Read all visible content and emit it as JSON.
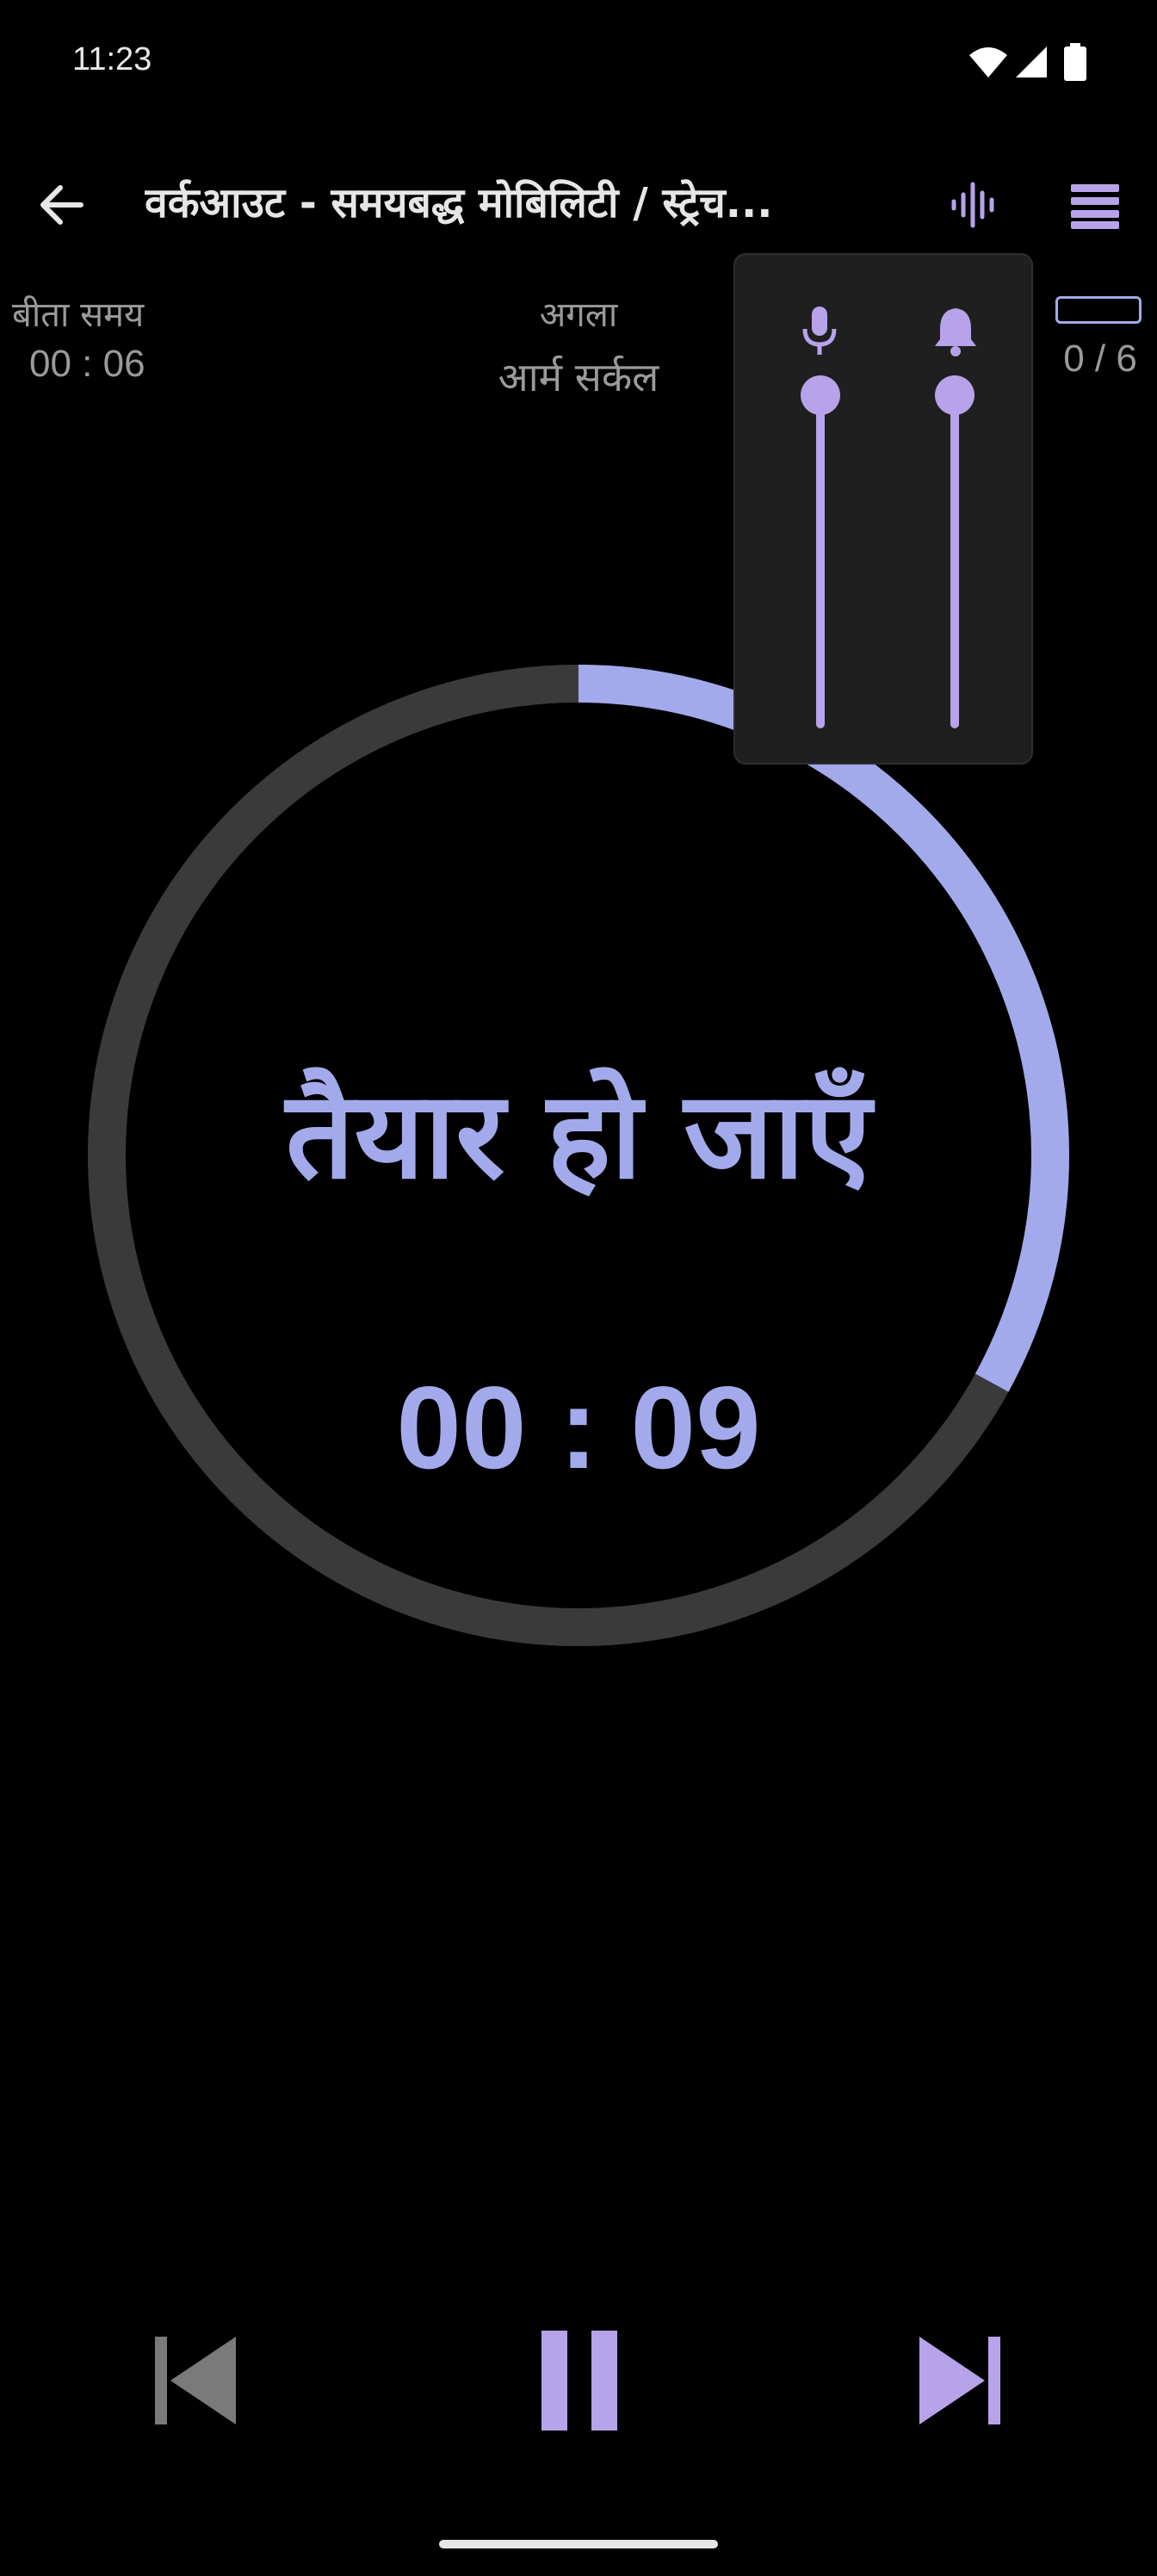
{
  "status_bar": {
    "time": "11:23",
    "icons": [
      "wifi-icon",
      "cellular-signal-icon",
      "battery-icon"
    ]
  },
  "app_bar": {
    "title": "वर्कआउट - समयबद्ध मोबिलिटी / स्ट्रेच...",
    "back_icon": "arrow-left-icon",
    "sound_icon": "audio-wave-icon",
    "menu_icon": "menu-icon"
  },
  "info": {
    "elapsed_label": "बीता समय",
    "elapsed_value": "00 : 06",
    "next_label": "अगला",
    "next_value": "आर्म सर्कल",
    "exercise_count": "0 / 6"
  },
  "timer": {
    "phase": "तैयार हो जाएँ",
    "countdown": "00 : 09",
    "ring_progress": 0.33
  },
  "volume_popup": {
    "voice_level": 1.0,
    "beep_level": 1.0,
    "voice_icon": "microphone-icon",
    "beep_icon": "bell-icon"
  },
  "controls": {
    "previous_icon": "skip-previous-icon",
    "pause_icon": "pause-icon",
    "next_icon": "skip-next-icon"
  },
  "colors": {
    "accent": "#a3aaeb",
    "accent_purple": "#b7a3ea",
    "ring_track": "#3a3a3a",
    "disabled": "#7a7a7a"
  }
}
